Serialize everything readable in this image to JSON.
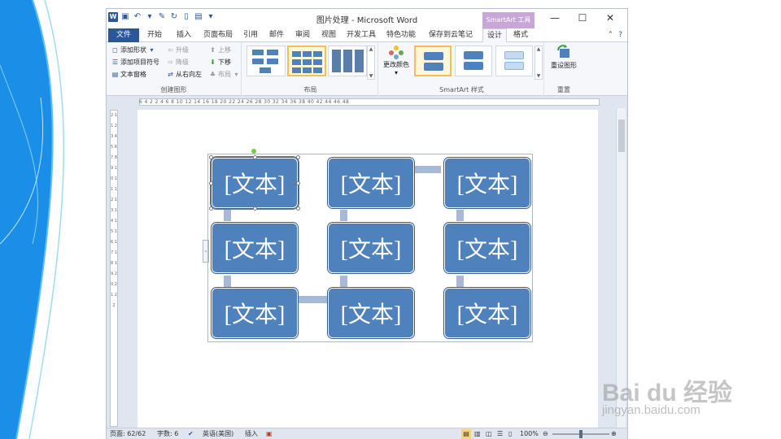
{
  "window": {
    "title": "图片处理 - Microsoft Word",
    "app_icon": "W",
    "context_tab_group": "SmartArt 工具",
    "controls": {
      "minimize": "—",
      "maximize": "☐",
      "close": "✕"
    }
  },
  "tabs": [
    {
      "label": "文件"
    },
    {
      "label": "开始"
    },
    {
      "label": "插入"
    },
    {
      "label": "页面布局"
    },
    {
      "label": "引用"
    },
    {
      "label": "邮件"
    },
    {
      "label": "审阅"
    },
    {
      "label": "视图"
    },
    {
      "label": "开发工具"
    },
    {
      "label": "特色功能"
    },
    {
      "label": "保存到云笔记"
    },
    {
      "label": "设计"
    },
    {
      "label": "格式"
    }
  ],
  "ribbon": {
    "create_graphic": {
      "label": "创建图形",
      "add_shape": "添加形状",
      "add_bullet": "添加项目符号",
      "text_pane": "文本窗格",
      "promote": "升级",
      "demote": "降级",
      "right_to_left": "从右向左",
      "move_up": "上移",
      "move_down": "下移",
      "layout": "布局"
    },
    "layouts": {
      "label": "布局"
    },
    "change_colors": "更改颜色",
    "smartart_styles": {
      "label": "SmartArt 样式"
    },
    "reset": {
      "label": "重置",
      "reset_graphic": "重设图形"
    }
  },
  "ruler": {
    "horizontal": "6 4 2 2 4 6 8 10 12 14 16 18 20 22 24 26 28 30 32 34 36 38 40 42 44 46 48",
    "vertical": "2 1 1 2 3 4 5 6 7 8 9 10 11 12 13 14 15 16 17 18 19 20 21 22"
  },
  "smartart": {
    "boxes": [
      "[文本]",
      "[文本]",
      "[文本]",
      "[文本]",
      "[文本]",
      "[文本]",
      "[文本]",
      "[文本]",
      "[文本]"
    ],
    "box_color": "#4f81bd",
    "connector_color": "#a7b9d7"
  },
  "status": {
    "page": "页面: 62/62",
    "words": "字数: 6",
    "language": "英语(美国)",
    "insert_mode": "插入",
    "zoom": "100%"
  },
  "watermark": {
    "main": "Bai du 经验",
    "sub": "jingyan.baidu.com"
  }
}
